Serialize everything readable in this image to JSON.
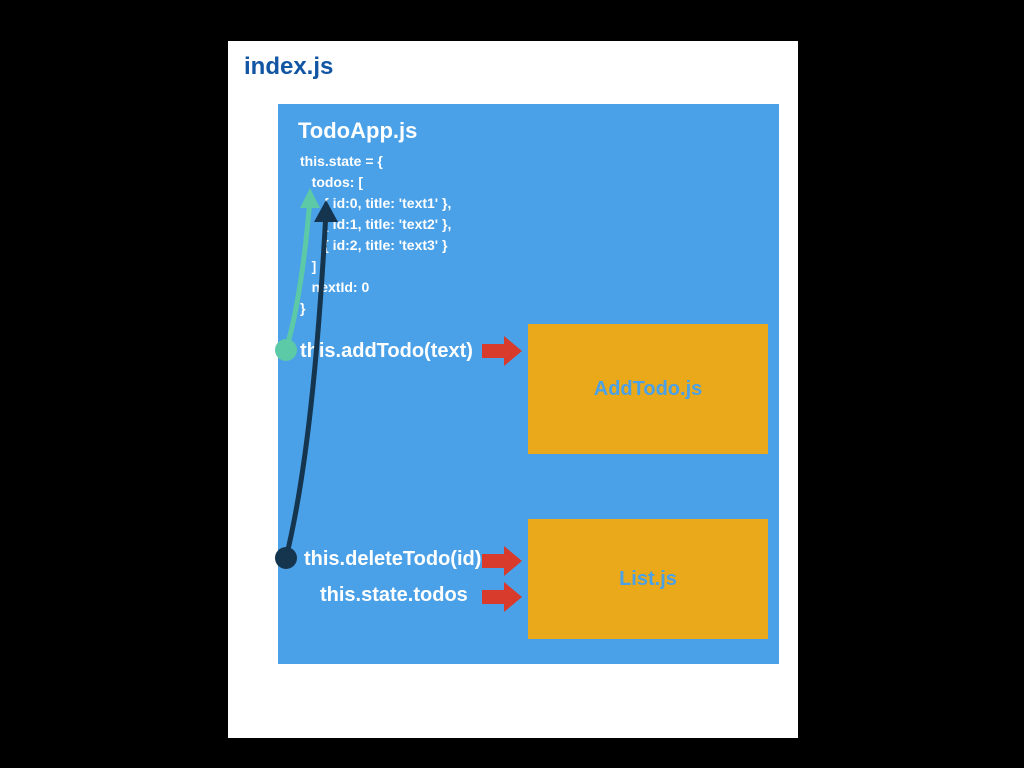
{
  "outer": {
    "title": "index.js"
  },
  "panel": {
    "title": "TodoApp.js"
  },
  "code": {
    "l1": "this.state = {",
    "l2": "   todos: [",
    "l3": "      { id:0, title: 'text1' },",
    "l4": "      { id:1, title: 'text2' },",
    "l5": "      { id:2, title: 'text3' }",
    "l6": "   ] ,",
    "l7": "   nextId: 0",
    "l8": "}"
  },
  "labels": {
    "addTodo": "this.addTodo(text)",
    "deleteTodo": "this.deleteTodo(id)",
    "stateTodos": "this.state.todos"
  },
  "children": {
    "addTodo": "AddTodo.js",
    "list": "List.js"
  },
  "colors": {
    "bg_black": "#000000",
    "panel_white": "#ffffff",
    "todo_blue": "#4ba1e8",
    "index_title": "#1155a3",
    "child_box": "#e9a91b",
    "arrow_red": "#d83a2b",
    "teal_line": "#5cc9a7",
    "dark_line": "#15354f"
  }
}
